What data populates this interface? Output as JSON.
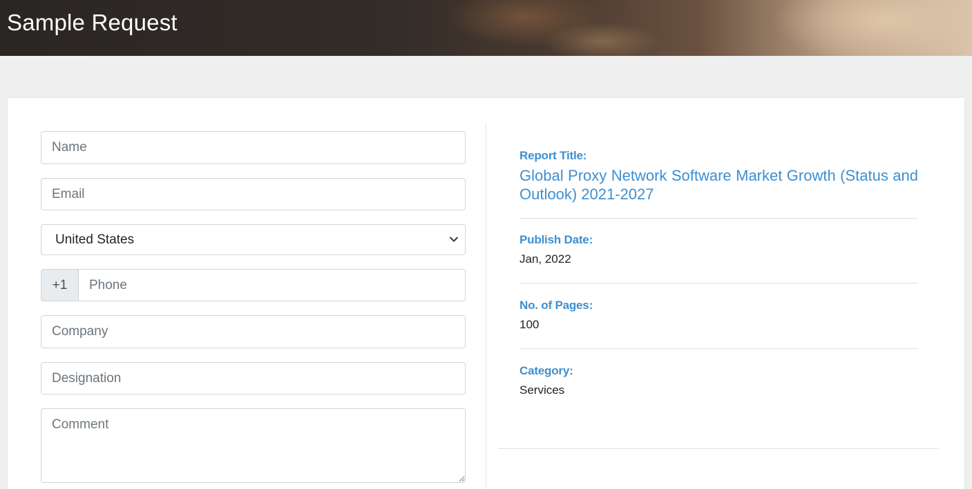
{
  "header": {
    "title": "Sample Request"
  },
  "form": {
    "name_placeholder": "Name",
    "email_placeholder": "Email",
    "country_selected": "United States",
    "phone_prefix": "+1",
    "phone_placeholder": "Phone",
    "company_placeholder": "Company",
    "designation_placeholder": "Designation",
    "comment_placeholder": "Comment"
  },
  "report": {
    "title_label": "Report Title:",
    "title_value": "Global Proxy Network Software Market Growth (Status and Outlook) 2021-2027",
    "publish_label": "Publish Date:",
    "publish_value": "Jan, 2022",
    "pages_label": "No. of Pages:",
    "pages_value": "100",
    "category_label": "Category:",
    "category_value": "Services"
  },
  "colors": {
    "accent": "#3d8fd0",
    "page_bg": "#efefef"
  },
  "icons": {
    "select": "chevron-down-icon",
    "textarea": "resize-handle-icon"
  }
}
